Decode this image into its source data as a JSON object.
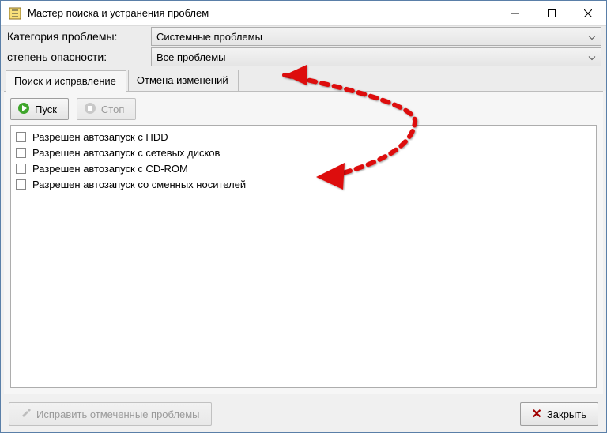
{
  "window": {
    "title": "Мастер поиска и устранения проблем"
  },
  "filters": {
    "category_label": "Категория проблемы:",
    "category_value": "Системные проблемы",
    "severity_label": "степень опасности:",
    "severity_value": "Все проблемы"
  },
  "tabs": {
    "search_fix": "Поиск и исправление",
    "undo": "Отмена изменений"
  },
  "buttons": {
    "start": "Пуск",
    "stop": "Стоп",
    "fix": "Исправить отмеченные проблемы",
    "close": "Закрыть"
  },
  "items": [
    "Разрешен автозапуск с HDD",
    "Разрешен автозапуск с сетевых дисков",
    "Разрешен автозапуск с CD-ROM",
    "Разрешен автозапуск со сменных носителей"
  ]
}
